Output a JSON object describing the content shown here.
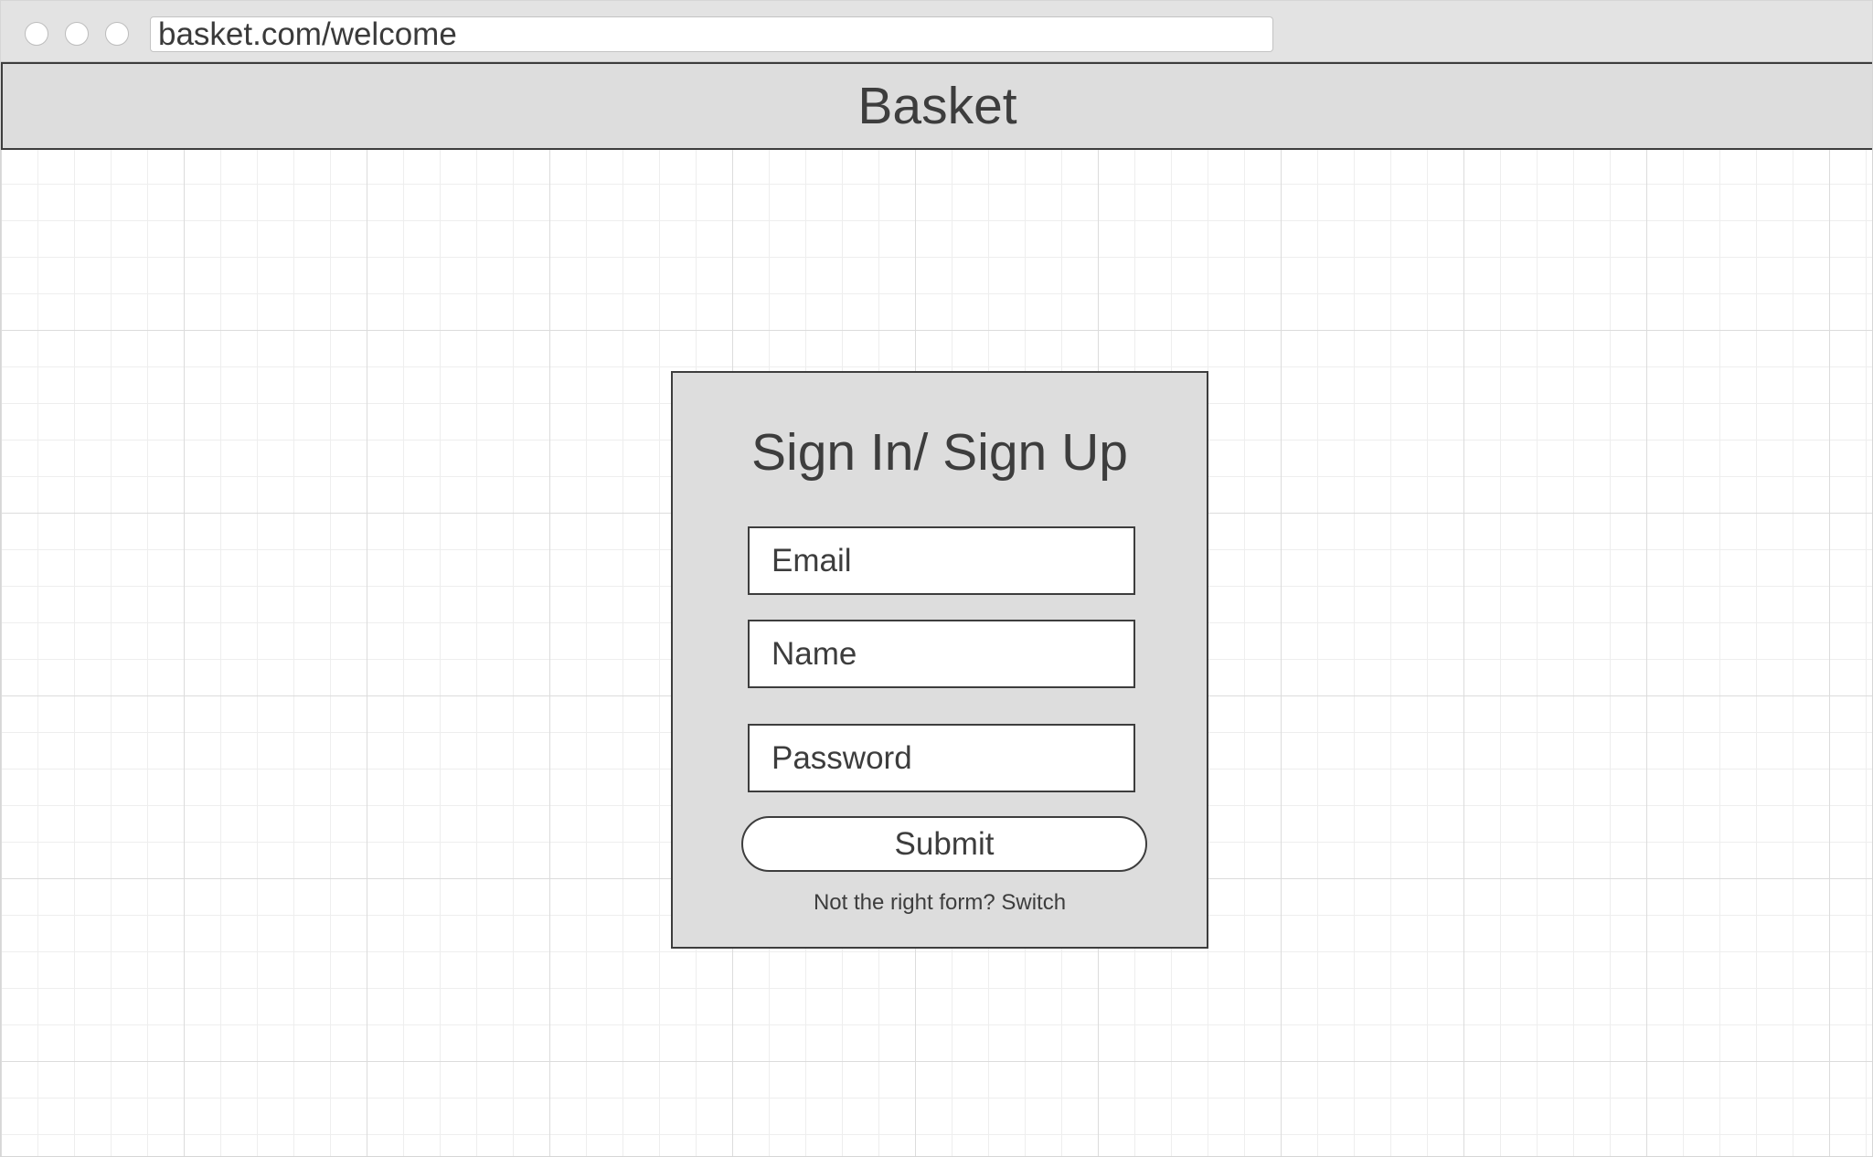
{
  "browser": {
    "url": "basket.com/welcome"
  },
  "header": {
    "title": "Basket"
  },
  "form": {
    "title": "Sign In/ Sign Up",
    "email_placeholder": "Email",
    "name_placeholder": "Name",
    "password_placeholder": "Password",
    "submit_label": "Submit",
    "switch_prompt": "Not the right form? ",
    "switch_link": "Switch"
  },
  "colors": {
    "header_background": "#dddddd",
    "card_background": "#dddddd",
    "border": "#3d3d3d",
    "text": "#3d3d3d"
  }
}
